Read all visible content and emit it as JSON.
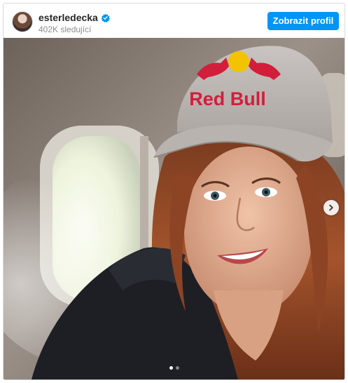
{
  "header": {
    "username": "esterledecka",
    "followers": "402K sledující",
    "profile_button": "Zobrazit profil",
    "verified_icon": "verified-badge-icon"
  },
  "media": {
    "cap_text": "Red Bull",
    "carousel": {
      "current": 1,
      "total": 2
    },
    "next_icon": "chevron-right-icon"
  },
  "colors": {
    "accent": "#0095f6",
    "verified": "#0095f6",
    "cap_red": "#d21e3b",
    "cap_gold": "#f4c300"
  }
}
